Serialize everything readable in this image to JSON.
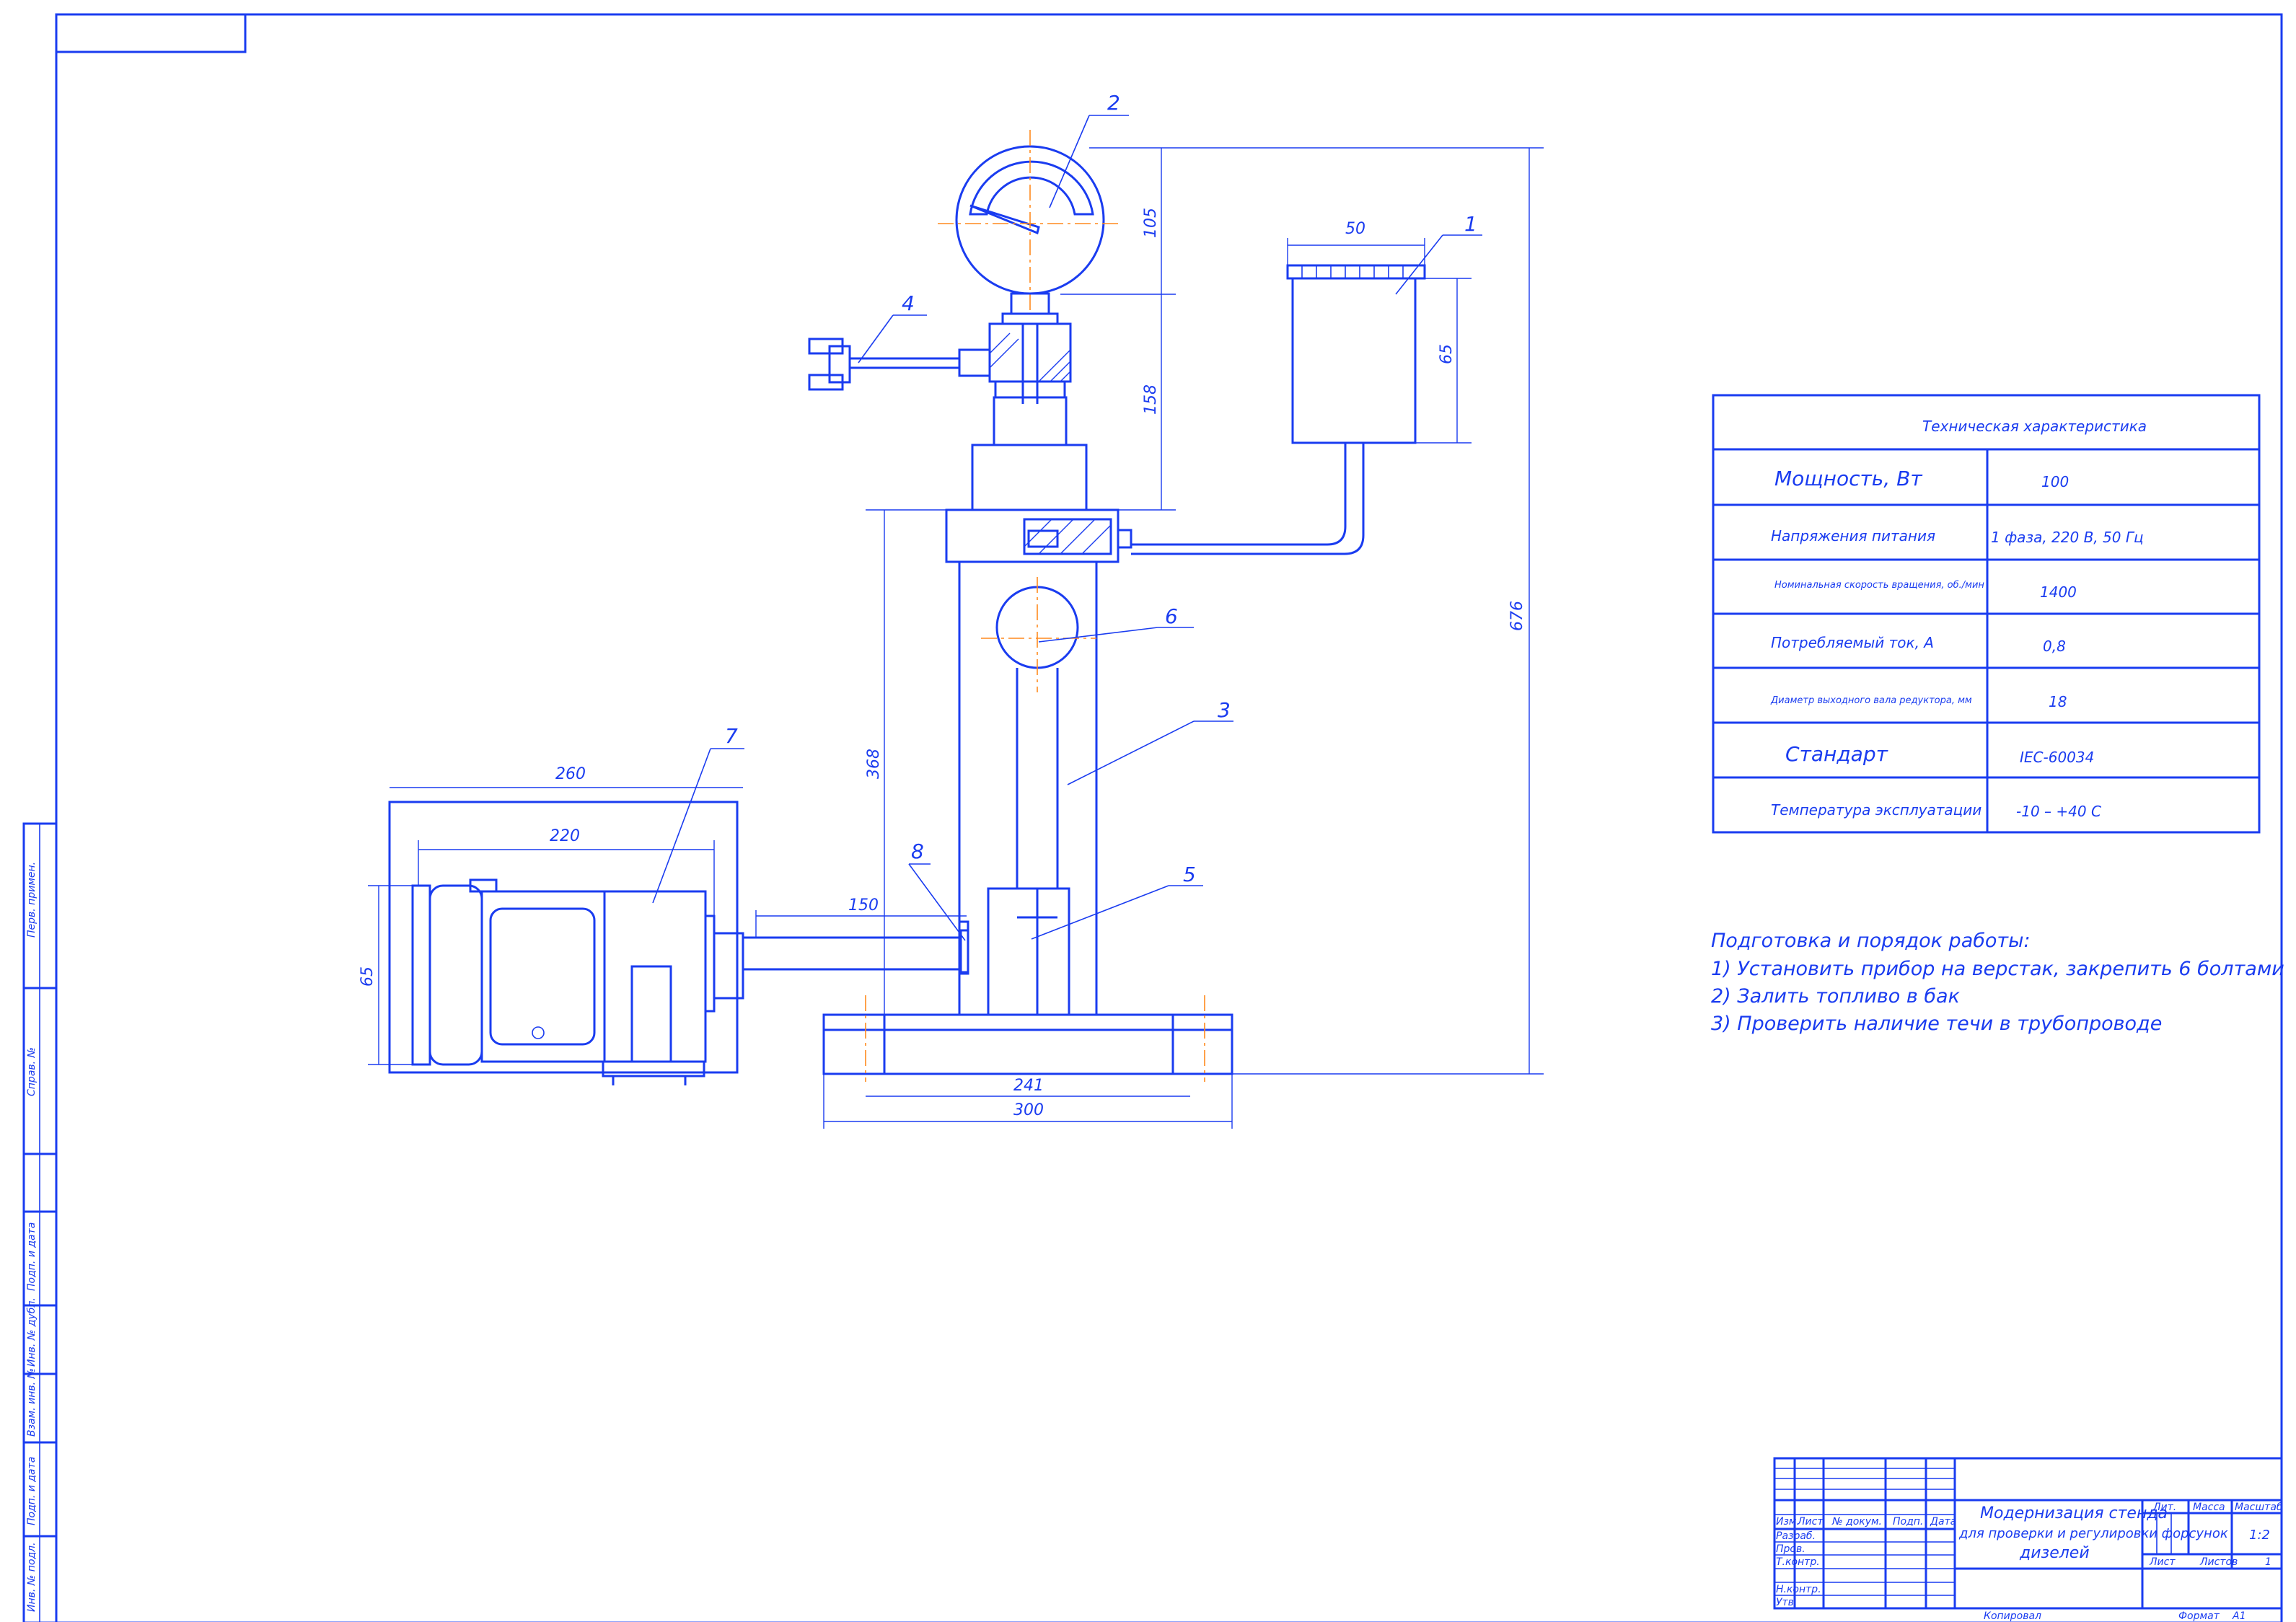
{
  "dimensions": {
    "gauge_height": "105",
    "pump_height": "158",
    "total_height": "676",
    "stand_height": "368",
    "tank_width": "50",
    "tank_height": "65",
    "motor_frame_width": "260",
    "motor_body_width": "220",
    "motor_height": "65",
    "shaft_length": "150",
    "base_inner_width": "241",
    "base_width": "300"
  },
  "positions": [
    "1",
    "2",
    "3",
    "4",
    "5",
    "6",
    "7",
    "8"
  ],
  "spec_table": {
    "title": "Техническая характеристика",
    "rows": [
      {
        "label": "Мощность, Вт",
        "value": "100",
        "size": "lg"
      },
      {
        "label": "Напряжения питания",
        "value": "1 фаза, 220 В, 50 Гц",
        "size": "md"
      },
      {
        "label": "Номинальная скорость вращения, об./мин",
        "value": "1400",
        "size": "sm"
      },
      {
        "label": "Потребляемый ток, А",
        "value": "0,8",
        "size": "md"
      },
      {
        "label": "Диаметр выходного вала редуктора, мм",
        "value": "18",
        "size": "sm"
      },
      {
        "label": "Стандарт",
        "value": "IEC-60034",
        "size": "lg"
      },
      {
        "label": "Температура эксплуатации",
        "value": "-10 – +40 С",
        "size": "md"
      }
    ]
  },
  "notes": {
    "title": "Подготовка и порядок работы:",
    "items": [
      "1) Установить прибор на верстак, закрепить 6 болтами",
      "2) Залить топливо в бак",
      "3) Проверить наличие течи в трубопроводе"
    ]
  },
  "title_block": {
    "title_line1": "Модернизация стенда",
    "title_line2": "для проверки и регулировки форсунок",
    "title_line3": "дизелей",
    "col_izm": "Изм.",
    "col_list": "Лист",
    "col_doc": "№ докум.",
    "col_sign": "Подп.",
    "col_date": "Дата",
    "row_razrab": "Разраб.",
    "row_prov": "Пров.",
    "row_tkontr": "Т.контр.",
    "row_nkontr": "Н.контр.",
    "row_utv": "Утв.",
    "lit": "Лит.",
    "massa": "Масса",
    "masshtab": "Масштаб",
    "scale_value": "1:2",
    "sheet": "Лист",
    "sheets": "Листов",
    "sheets_value": "1",
    "copied": "Копировал",
    "format": "Формат",
    "format_value": "А1"
  },
  "side_strip": {
    "perv_primen": "Перв. примен.",
    "sprav": "Справ. №",
    "podp_data1": "Подп. и дата",
    "inv_dubl": "Инв. № дубл.",
    "vzam_inv": "Взам. инв. №",
    "podp_data2": "Подп. и дата",
    "inv_podl": "Инв. № подл."
  }
}
